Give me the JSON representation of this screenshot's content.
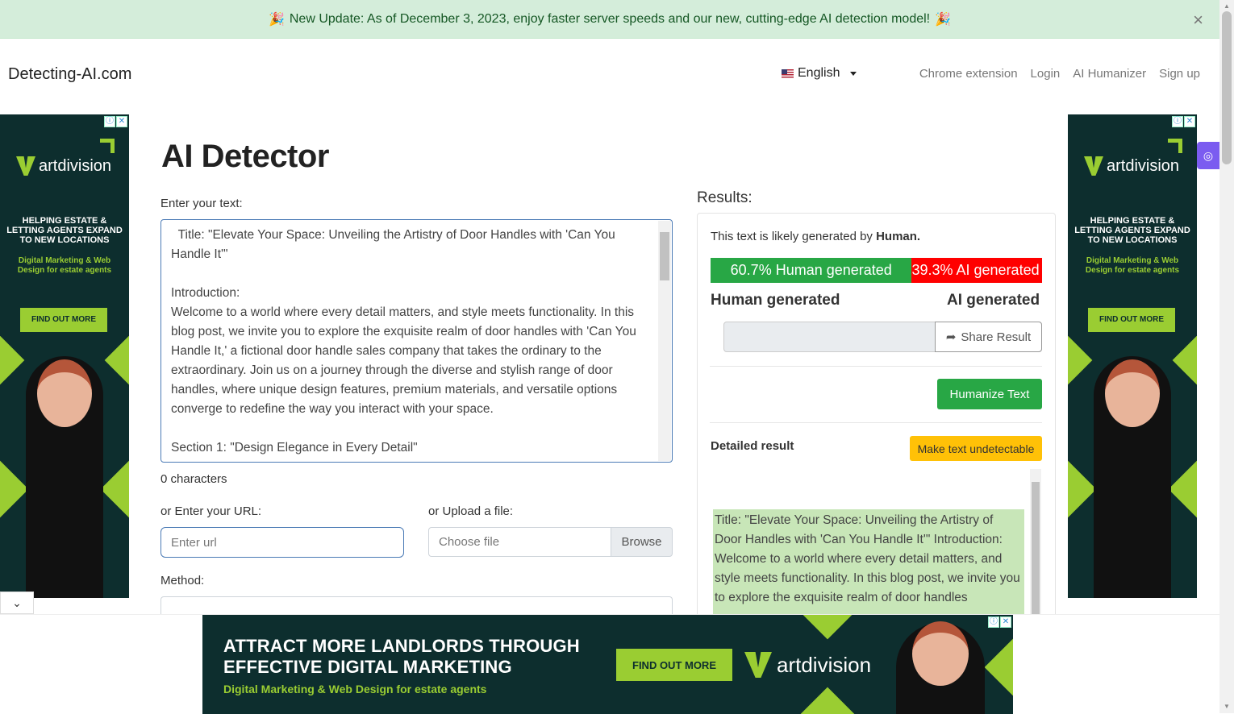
{
  "banner": {
    "emoji": "🎉",
    "text": "New Update: As of December 3, 2023, enjoy faster server speeds and our new, cutting-edge AI detection model!",
    "close": "×"
  },
  "nav": {
    "brand": "Detecting-AI.com",
    "language": "English",
    "links": [
      "Chrome extension",
      "Login",
      "AI Humanizer",
      "Sign up"
    ]
  },
  "ad": {
    "brand": "artdivision",
    "side_headline": "HELPING ESTATE & LETTING AGENTS EXPAND TO NEW LOCATIONS",
    "side_sub": "Digital Marketing & Web Design for estate agents",
    "cta": "FIND OUT MORE",
    "bottom_headline1": "ATTRACT MORE LANDLORDS THROUGH",
    "bottom_headline2": "EFFECTIVE DIGITAL MARKETING",
    "bottom_sub": "Digital Marketing & Web Design for estate agents",
    "icons": [
      "ⓘ",
      "✕"
    ]
  },
  "page": {
    "title": "AI Detector",
    "enter_text_label": "Enter your text:",
    "text_value": "  Title: \"Elevate Your Space: Unveiling the Artistry of Door Handles with 'Can You Handle It'\"\n\nIntroduction:\nWelcome to a world where every detail matters, and style meets functionality. In this blog post, we invite you to explore the exquisite realm of door handles with 'Can You Handle It,' a fictional door handle sales company that takes the ordinary to the extraordinary. Join us on a journey through the diverse and stylish range of door handles, where unique design features, premium materials, and versatile options converge to redefine the way you interact with your space.\n\nSection 1: \"Design Elegance in Every Detail\"",
    "char_count": "0 characters",
    "url_label": "or Enter your URL:",
    "url_placeholder": "Enter url",
    "upload_label": "or Upload a file:",
    "choose_file": "Choose file",
    "browse": "Browse",
    "method_label": "Method:"
  },
  "results": {
    "heading": "Results:",
    "likely_prefix": "This text is likely generated by ",
    "likely_value": "Human.",
    "human_pct": 60.7,
    "human_bar_label": "60.7% Human generated",
    "ai_bar_label": "39.3% AI generated",
    "human_label": "Human generated",
    "ai_label": "AI generated",
    "share": "Share Result",
    "humanize": "Humanize Text",
    "detailed": "Detailed result",
    "undetectable": "Make text undetectable",
    "detail_text": "Title: \"Elevate Your Space: Unveiling the Artistry of Door Handles with 'Can You Handle It'\" Introduction: Welcome to a world where every detail matters, and style meets functionality. In this blog post, we invite you to explore the exquisite realm of door handles",
    "colors": {
      "human": "#28a745",
      "ai": "#ff0000",
      "highlight": "#c8e6b8"
    }
  }
}
